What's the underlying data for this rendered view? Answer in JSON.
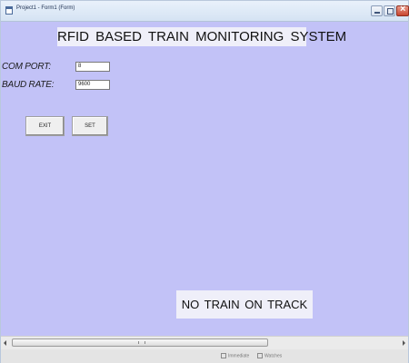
{
  "window": {
    "title": "Project1 - Form1 (Form)"
  },
  "form": {
    "header": "RFID BASED TRAIN MONITORING   SYSTEM",
    "com_port_label": "COM PORT:",
    "com_port_value": "8",
    "baud_rate_label": "BAUD RATE:",
    "baud_rate_value": "9600",
    "exit_label": "EXIT",
    "set_label": "SET",
    "status": "NO  TRAIN  ON TRACK"
  },
  "bottombar": {
    "item1": "Immediate",
    "item2": "Watches"
  },
  "colors": {
    "form_background": "#c2c2f7",
    "label_background": "#efeff9",
    "close_button": "#c8452f"
  },
  "icons": [
    "app-icon",
    "minimize-icon",
    "maximize-icon",
    "close-icon",
    "scroll-left-icon",
    "scroll-right-icon"
  ]
}
